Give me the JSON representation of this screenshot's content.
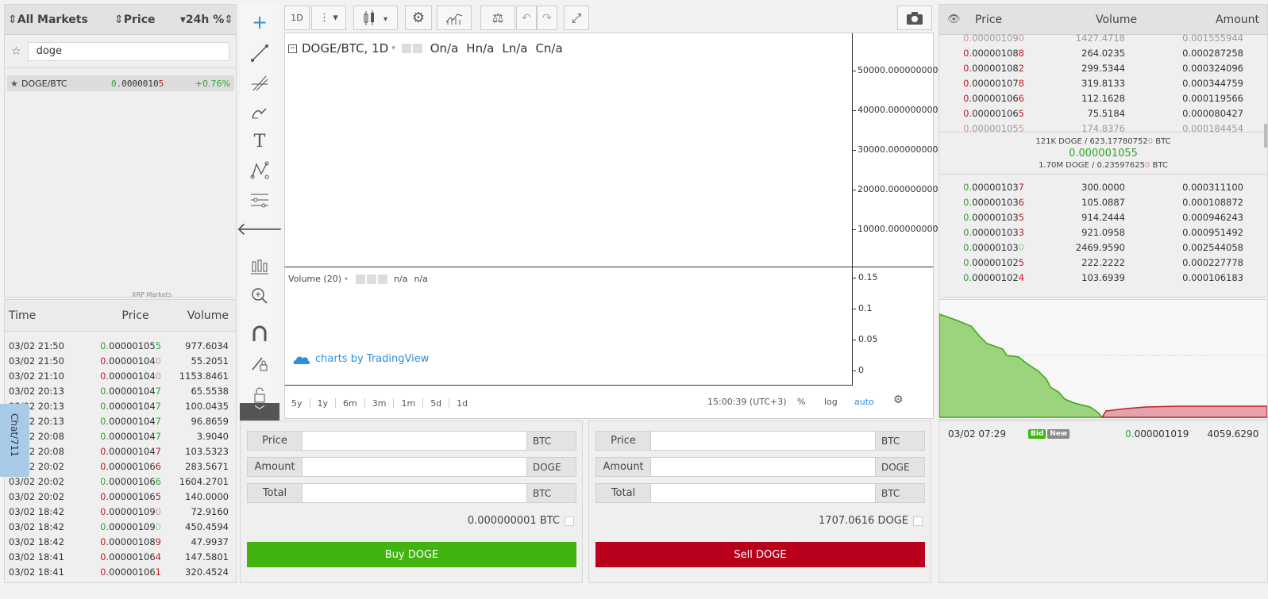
{
  "markets": {
    "header": {
      "col1": "All Markets",
      "col2": "Price",
      "col3": "24h %"
    },
    "search": {
      "value": "doge",
      "placeholder": ""
    },
    "rows": [
      {
        "pair": "DOGE/BTC",
        "price_main": "0.00000105",
        "price_tail": "5",
        "price_lead": "0.",
        "change": "+0.76%"
      }
    ],
    "xrp_label": "XRP Markets"
  },
  "trades": {
    "header": {
      "time": "Time",
      "price": "Price",
      "volume": "Volume"
    },
    "rows": [
      {
        "time": "03/02 21:50",
        "lead": "0.",
        "mid": "00000105",
        "tail": "5",
        "side": "g",
        "tail_dim": false,
        "volume": "977.6034"
      },
      {
        "time": "03/02 21:50",
        "lead": "0.",
        "mid": "00000104",
        "tail": "0",
        "side": "r",
        "tail_dim": true,
        "volume": "55.2051"
      },
      {
        "time": "03/02 21:10",
        "lead": "0.",
        "mid": "00000104",
        "tail": "0",
        "side": "r",
        "tail_dim": true,
        "volume": "1153.8461"
      },
      {
        "time": "03/02 20:13",
        "lead": "0.",
        "mid": "00000104",
        "tail": "7",
        "side": "g",
        "tail_dim": false,
        "volume": "65.5538"
      },
      {
        "time": "03/02 20:13",
        "lead": "0.",
        "mid": "00000104",
        "tail": "7",
        "side": "g",
        "tail_dim": false,
        "volume": "100.0435"
      },
      {
        "time": "03/02 20:13",
        "lead": "0.",
        "mid": "00000104",
        "tail": "7",
        "side": "g",
        "tail_dim": false,
        "volume": "96.8659"
      },
      {
        "time": "03/02 20:08",
        "lead": "0.",
        "mid": "00000104",
        "tail": "7",
        "side": "g",
        "tail_dim": false,
        "volume": "3.9040"
      },
      {
        "time": "03/02 20:08",
        "lead": "0.",
        "mid": "00000104",
        "tail": "7",
        "side": "r",
        "tail_dim": false,
        "volume": "103.5323"
      },
      {
        "time": "03/02 20:02",
        "lead": "0.",
        "mid": "00000106",
        "tail": "6",
        "side": "r",
        "tail_dim": false,
        "volume": "283.5671"
      },
      {
        "time": "03/02 20:02",
        "lead": "0.",
        "mid": "00000106",
        "tail": "6",
        "side": "g",
        "tail_dim": false,
        "volume": "1604.2701"
      },
      {
        "time": "03/02 20:02",
        "lead": "0.",
        "mid": "00000106",
        "tail": "5",
        "side": "r",
        "tail_dim": false,
        "volume": "140.0000"
      },
      {
        "time": "03/02 18:42",
        "lead": "0.",
        "mid": "00000109",
        "tail": "0",
        "side": "r",
        "tail_dim": true,
        "volume": "72.9160"
      },
      {
        "time": "03/02 18:42",
        "lead": "0.",
        "mid": "00000109",
        "tail": "0",
        "side": "g",
        "tail_dim": true,
        "volume": "450.4594"
      },
      {
        "time": "03/02 18:42",
        "lead": "0.",
        "mid": "00000108",
        "tail": "9",
        "side": "r",
        "tail_dim": false,
        "volume": "47.9937"
      },
      {
        "time": "03/02 18:41",
        "lead": "0.",
        "mid": "00000106",
        "tail": "4",
        "side": "r",
        "tail_dim": false,
        "volume": "147.5801"
      },
      {
        "time": "03/02 18:41",
        "lead": "0.",
        "mid": "00000106",
        "tail": "1",
        "side": "r",
        "tail_dim": false,
        "volume": "320.4524"
      }
    ]
  },
  "chat": {
    "label": "Chat/711"
  },
  "toolbar": {
    "interval": "1D"
  },
  "chart": {
    "legend": {
      "symbol": "DOGE/BTC, 1D",
      "o": "On/a",
      "h": "Hn/a",
      "l": "Ln/a",
      "c": "Cn/a"
    },
    "y_ticks": [
      "50000.000000000",
      "40000.000000000",
      "30000.000000000",
      "20000.000000000",
      "10000.000000000"
    ],
    "volume": {
      "label": "Volume (20)",
      "v1": "n/a",
      "v2": "n/a",
      "ticks": [
        "0.15",
        "0.1",
        "0.05",
        "0"
      ]
    },
    "branding": "charts by TradingView",
    "ranges": [
      "5y",
      "1y",
      "6m",
      "3m",
      "1m",
      "5d",
      "1d"
    ],
    "time": "15:00:39 (UTC+3)",
    "pct": "%",
    "log": "log",
    "auto": "auto"
  },
  "buy_form": {
    "price_label": "Price",
    "price_cur": "BTC",
    "amount_label": "Amount",
    "amount_cur": "DOGE",
    "total_label": "Total",
    "total_cur": "BTC",
    "balance": "0.000000001 BTC",
    "button": "Buy DOGE",
    "color": "#41b411"
  },
  "sell_form": {
    "price_label": "Price",
    "price_cur": "BTC",
    "amount_label": "Amount",
    "amount_cur": "DOGE",
    "total_label": "Total",
    "total_cur": "BTC",
    "balance": "1707.0616 DOGE",
    "button": "Sell DOGE",
    "color": "#b8001b"
  },
  "orderbook": {
    "header": {
      "price": "Price",
      "volume": "Volume",
      "amount": "Amount"
    },
    "asks": [
      {
        "lead": "0.",
        "mid": "00000109",
        "tail": "0",
        "volume": "1427.4718",
        "amount": "0.001555944",
        "faded": true
      },
      {
        "lead": "0.",
        "mid": "00000108",
        "tail": "8",
        "volume": "264.0235",
        "amount": "0.000287258",
        "faded": false
      },
      {
        "lead": "0.",
        "mid": "00000108",
        "tail": "2",
        "volume": "299.5344",
        "amount": "0.000324096",
        "faded": false
      },
      {
        "lead": "0.",
        "mid": "00000107",
        "tail": "8",
        "volume": "319.8133",
        "amount": "0.000344759",
        "faded": false
      },
      {
        "lead": "0.",
        "mid": "00000106",
        "tail": "6",
        "volume": "112.1628",
        "amount": "0.000119566",
        "faded": false
      },
      {
        "lead": "0.",
        "mid": "00000106",
        "tail": "5",
        "volume": "75.5184",
        "amount": "0.000080427",
        "faded": false
      },
      {
        "lead": "0.",
        "mid": "00000105",
        "tail": "5",
        "volume": "174.8376",
        "amount": "0.000184454",
        "faded": true
      }
    ],
    "spread": {
      "top": "121K DOGE  /  623.17780752",
      "top_tail": "0",
      "top_cur": " BTC",
      "price": "0.000001055",
      "bottom": "1.70M DOGE  /  0.23597625",
      "bottom_tail": "0",
      "bottom_cur": " BTC"
    },
    "bids": [
      {
        "lead": "0.",
        "mid": "00000103",
        "tail": "7",
        "volume": "300.0000",
        "amount": "0.000311100",
        "tail_dim": false
      },
      {
        "lead": "0.",
        "mid": "00000103",
        "tail": "6",
        "volume": "105.0887",
        "amount": "0.000108872",
        "tail_dim": false
      },
      {
        "lead": "0.",
        "mid": "00000103",
        "tail": "5",
        "volume": "914.2444",
        "amount": "0.000946243",
        "tail_dim": false
      },
      {
        "lead": "0.",
        "mid": "00000103",
        "tail": "3",
        "volume": "921.0958",
        "amount": "0.000951492",
        "tail_dim": false
      },
      {
        "lead": "0.",
        "mid": "00000103",
        "tail": "0",
        "volume": "2469.9590",
        "amount": "0.002544058",
        "tail_dim": true
      },
      {
        "lead": "0.",
        "mid": "00000102",
        "tail": "5",
        "volume": "222.2222",
        "amount": "0.000227778",
        "tail_dim": false
      },
      {
        "lead": "0.",
        "mid": "00000102",
        "tail": "4",
        "volume": "103.6939",
        "amount": "0.000106183",
        "tail_dim": false
      }
    ]
  },
  "tape": {
    "time": "03/02 07:29",
    "badge1": "Bid",
    "badge2": "New",
    "price": "0.000001019",
    "volume": "4059.6290"
  },
  "colors": {
    "green": "#2fa52f",
    "red": "#c0202a",
    "accent_blue": "#2f8fd8"
  }
}
